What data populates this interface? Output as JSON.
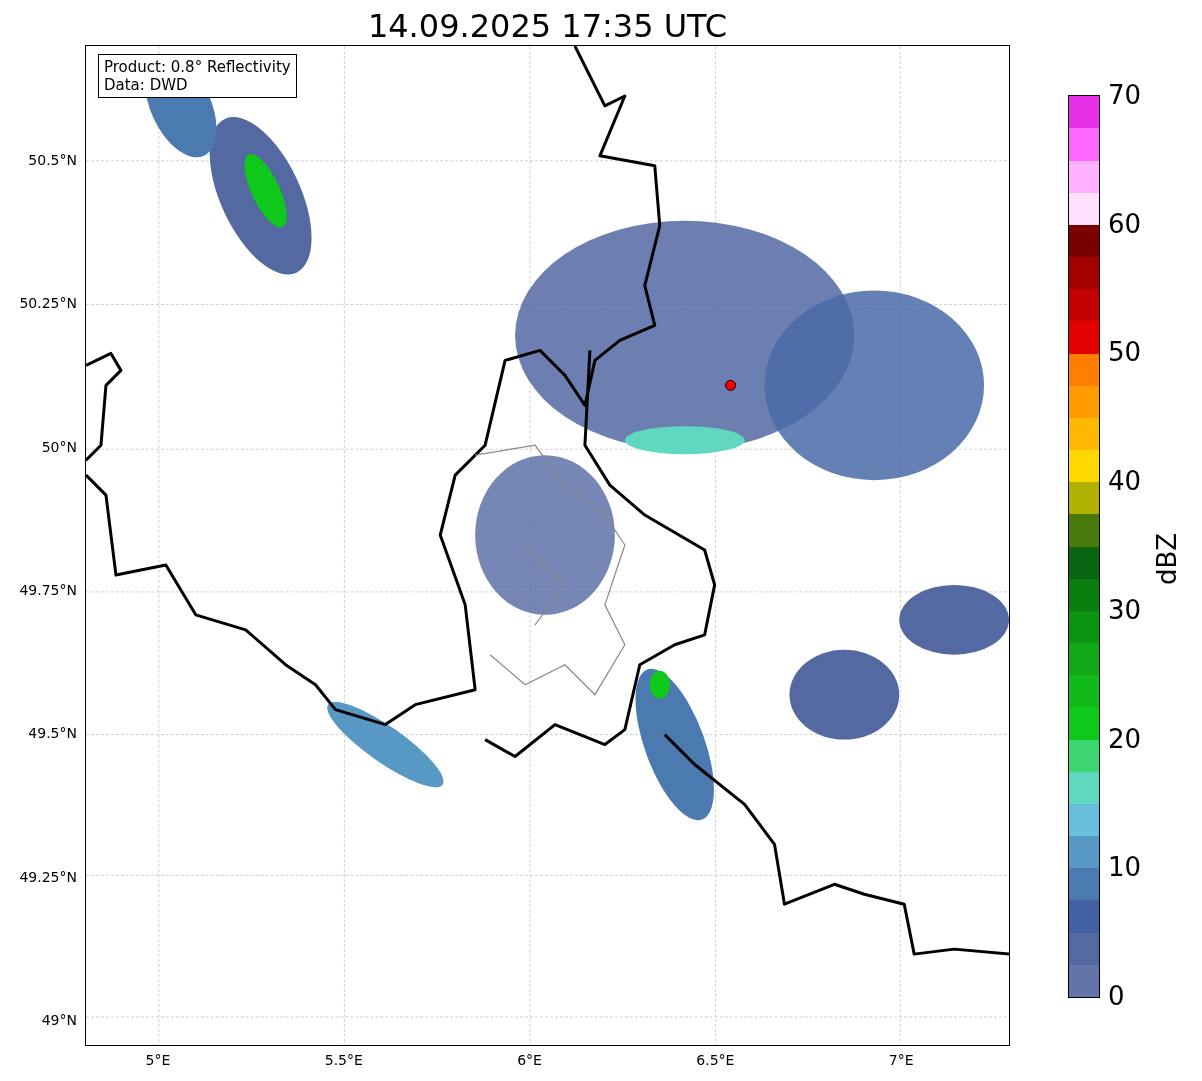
{
  "title": "14.09.2025 17:35 UTC",
  "info_box": {
    "lines": [
      "Product: 0.8° Reflectivity",
      "Data: DWD"
    ]
  },
  "map": {
    "y_ticks": [
      "50.5°N",
      "50.25°N",
      "50°N",
      "49.75°N",
      "49.5°N",
      "49.25°N",
      "49°N"
    ],
    "x_ticks": [
      "5°E",
      "5.5°E",
      "6°E",
      "6.5°E",
      "7°E"
    ]
  },
  "colorbar": {
    "label": "dBZ",
    "ticks": [
      "70",
      "60",
      "50",
      "40",
      "30",
      "20",
      "10",
      "0"
    ],
    "segments": [
      {
        "color": "#6474a8"
      },
      {
        "color": "#5468a2"
      },
      {
        "color": "#4460a4"
      },
      {
        "color": "#4a7ab0"
      },
      {
        "color": "#5898c4"
      },
      {
        "color": "#68c0dc"
      },
      {
        "color": "#60d8c0"
      },
      {
        "color": "#3cd670"
      },
      {
        "color": "#10c81a"
      },
      {
        "color": "#10ba18"
      },
      {
        "color": "#10a814"
      },
      {
        "color": "#0c9410"
      },
      {
        "color": "#0a7e0e"
      },
      {
        "color": "#086610"
      },
      {
        "color": "#4a7a0a"
      },
      {
        "color": "#b0b000"
      },
      {
        "color": "#ffd800"
      },
      {
        "color": "#ffb800"
      },
      {
        "color": "#ff9c00"
      },
      {
        "color": "#ff7e00"
      },
      {
        "color": "#e40000"
      },
      {
        "color": "#c40000"
      },
      {
        "color": "#a40000"
      },
      {
        "color": "#7a0000"
      },
      {
        "color": "#ffe0ff"
      },
      {
        "color": "#ffb0ff"
      },
      {
        "color": "#ff68ff"
      },
      {
        "color": "#e830e8"
      }
    ]
  }
}
